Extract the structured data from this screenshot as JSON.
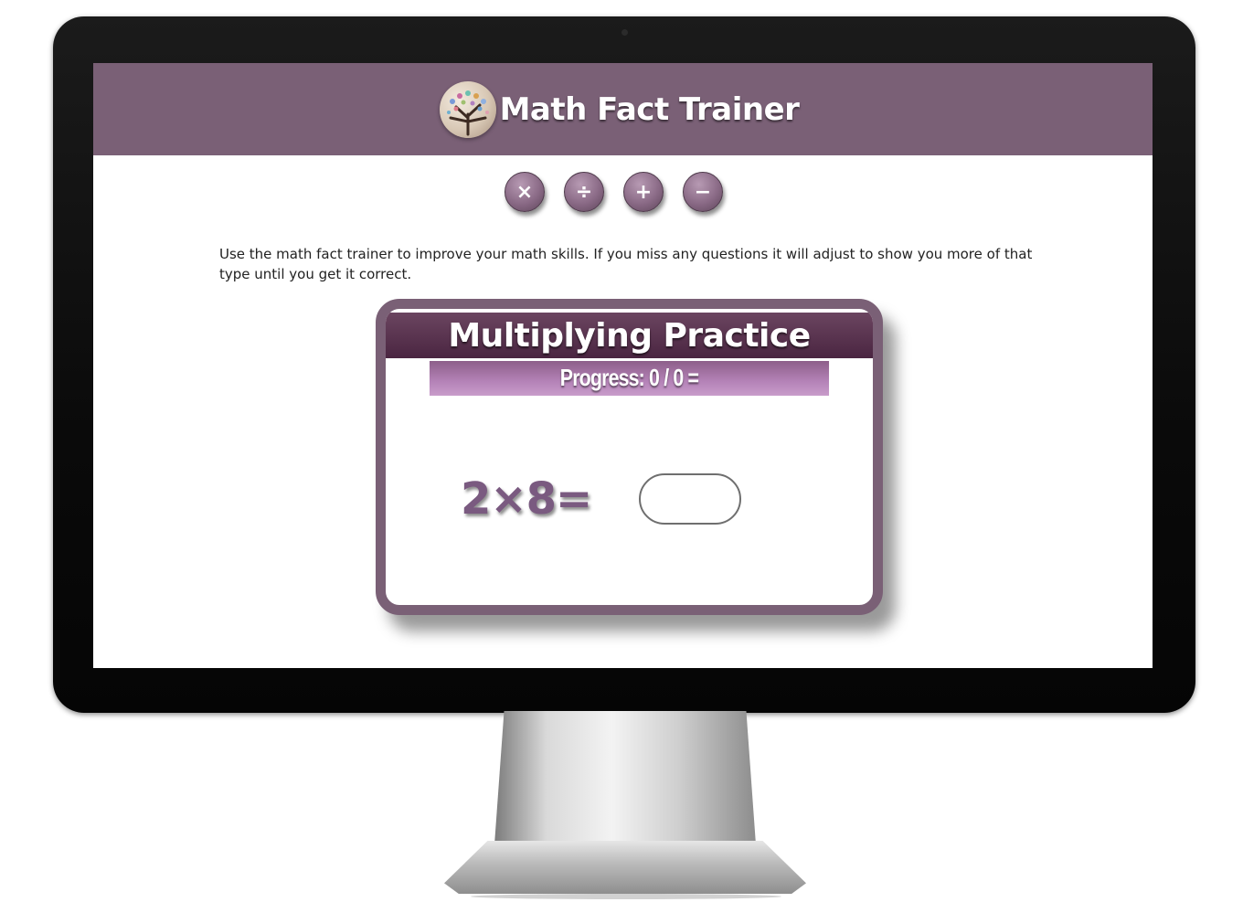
{
  "app": {
    "title": "Math Fact Trainer",
    "logo_icon": "tree-logo-icon"
  },
  "operations": [
    {
      "symbol": "×",
      "name": "multiply"
    },
    {
      "symbol": "÷",
      "name": "divide"
    },
    {
      "symbol": "+",
      "name": "add"
    },
    {
      "symbol": "−",
      "name": "subtract"
    }
  ],
  "intro_text": "Use the math fact trainer to improve your math skills. If you miss any questions it will adjust to show you more of that type until you get it correct.",
  "practice": {
    "title": "Multiplying Practice",
    "progress": "Progress: 0 / 0 =",
    "question": "2×8=",
    "answer_value": "",
    "answer_placeholder": ""
  },
  "colors": {
    "header": "#7a6076",
    "accent_dark": "#4a2541",
    "accent_light": "#c89cca",
    "question_text": "#7a5a80"
  }
}
